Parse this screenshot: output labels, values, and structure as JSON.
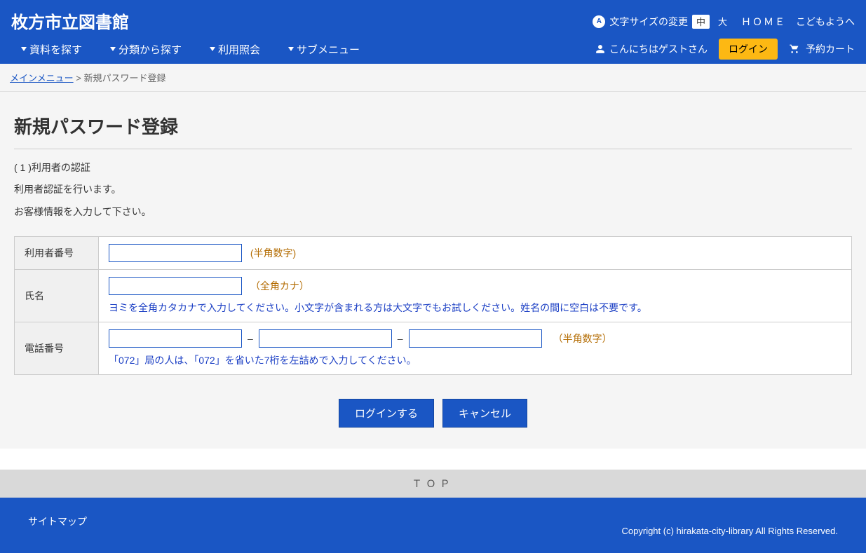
{
  "header": {
    "site_title": "枚方市立図書館",
    "font_size_label": "文字サイズの変更",
    "size_medium": "中",
    "size_large": "大",
    "home": "ＨＯＭＥ",
    "kids": "こどもようへ"
  },
  "nav": {
    "items": [
      {
        "label": "資料を探す"
      },
      {
        "label": "分類から探す"
      },
      {
        "label": "利用照会"
      },
      {
        "label": "サブメニュー"
      }
    ]
  },
  "user": {
    "greeting": "こんにちはゲストさん",
    "login": "ログイン",
    "cart": "予約カート"
  },
  "breadcrumb": {
    "main_menu": "メインメニュー",
    "sep": " > ",
    "current": "新規パスワード登録"
  },
  "page": {
    "title": "新規パスワード登録",
    "step_label": "( 1 )利用者の認証",
    "line1": "利用者認証を行います。",
    "line2": "お客様情報を入力して下さい。"
  },
  "form": {
    "user_no": {
      "label": "利用者番号",
      "hint": "(半角数字)"
    },
    "name": {
      "label": "氏名",
      "hint": "（全角カナ）",
      "note": "ヨミを全角カタカナで入力してください。小文字が含まれる方は大文字でもお試しください。姓名の間に空白は不要です。"
    },
    "tel": {
      "label": "電話番号",
      "hint": "（半角数字）",
      "sep": "–",
      "note": "「072」局の人は、「072」を省いた7桁を左詰めで入力してください。"
    }
  },
  "buttons": {
    "login": "ログインする",
    "cancel": "キャンセル"
  },
  "top_bar": "ＴＯＰ",
  "footer": {
    "sitemap": "サイトマップ",
    "copyright": "Copyright (c) hirakata-city-library All Rights Reserved."
  }
}
